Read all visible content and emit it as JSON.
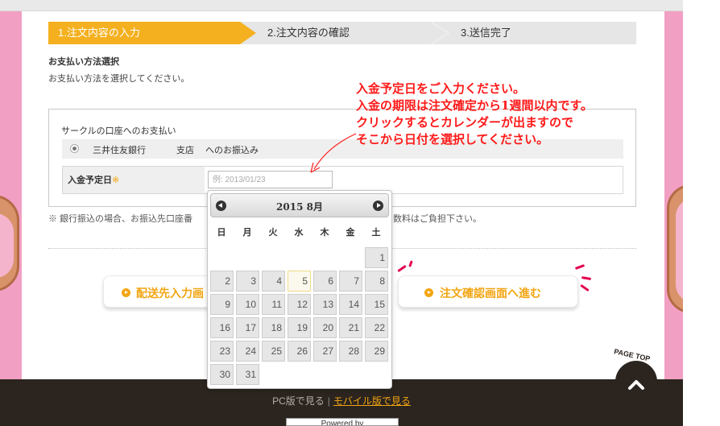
{
  "steps": [
    {
      "label": "1.注文内容の入力"
    },
    {
      "label": "2.注文内容の確認"
    },
    {
      "label": "3.送信完了"
    }
  ],
  "payment": {
    "section_title": "お支払い方法選択",
    "section_desc": "お支払い方法を選択してください。",
    "panel_heading": "サークルの口座へのお支払い",
    "bank_name": "三井住友銀行",
    "branch": "支店",
    "transfer": "へのお振込み",
    "date_label": "入金予定日",
    "required_mark": "※",
    "date_placeholder": "例: 2013/01/23",
    "note": "※ 銀行振込の場合、お振込先口座番",
    "note_tail": "数料はご負担下さい。"
  },
  "annotation": {
    "lines": [
      "入金予定日をご入力ください。",
      "入金の期限は注文確定から1週間以内です。",
      "クリックするとカレンダーが出ますので",
      "そこから日付を選択してください。"
    ],
    "color": "#ff1a1a"
  },
  "buttons": {
    "back": "配送先入力画",
    "next": "注文確認画面へ進む"
  },
  "calendar": {
    "title": "2015 8月",
    "weekdays": [
      "日",
      "月",
      "火",
      "水",
      "木",
      "金",
      "土"
    ],
    "today": "5",
    "weeks": [
      [
        "",
        "",
        "",
        "",
        "",
        "",
        "1"
      ],
      [
        "2",
        "3",
        "4",
        "5",
        "6",
        "7",
        "8"
      ],
      [
        "9",
        "10",
        "11",
        "12",
        "13",
        "14",
        "15"
      ],
      [
        "16",
        "17",
        "18",
        "19",
        "20",
        "21",
        "22"
      ],
      [
        "23",
        "24",
        "25",
        "26",
        "27",
        "28",
        "29"
      ],
      [
        "30",
        "31",
        "",
        "",
        "",
        "",
        ""
      ]
    ]
  },
  "footer": {
    "pc_link": "PC版で見る",
    "separator": "|",
    "mobile_link": "モバイル版で見る",
    "powered": "Powered by"
  },
  "pagetop": {
    "label": "PAGE TOP"
  },
  "colors": {
    "accent": "#f4b01f",
    "side_pink": "#f29fc4",
    "footer_bg": "#2b241f",
    "annotation_red": "#ff1a1a",
    "button_text": "#f3a512"
  }
}
